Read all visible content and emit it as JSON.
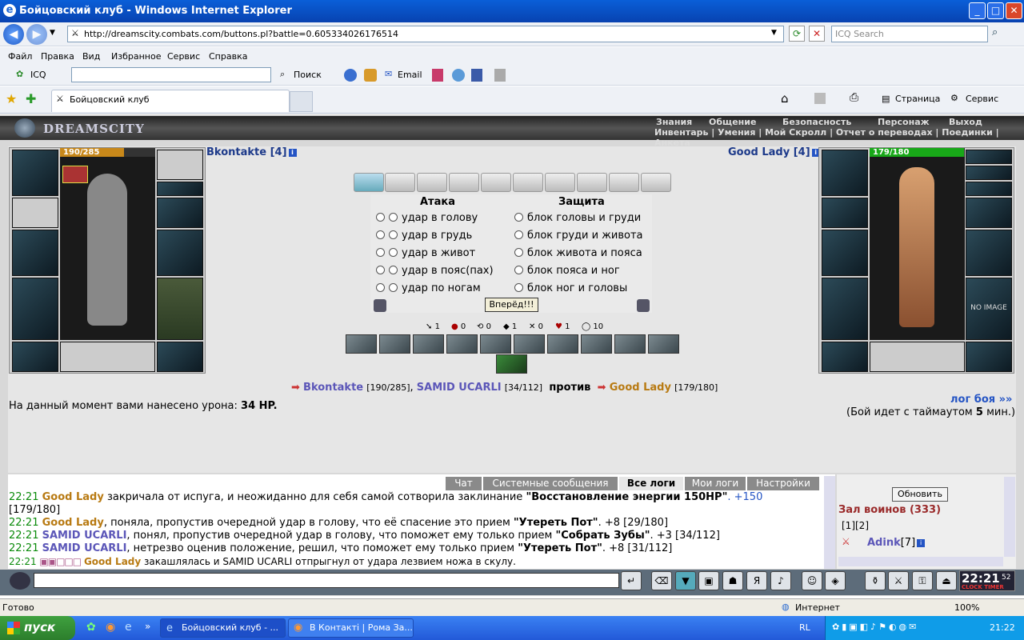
{
  "browser": {
    "window_title": "Бойцовский клуб - Windows Internet Explorer",
    "url": "http://dreamscity.combats.com/buttons.pl?battle=0.605334026176514",
    "search_placeholder": "ICQ Search",
    "menu": [
      "Файл",
      "Правка",
      "Вид",
      "Избранное",
      "Сервис",
      "Справка"
    ],
    "toolbar": {
      "icq": "ICQ",
      "search": "Поиск",
      "email": "Email"
    },
    "tab_title": "Бойцовский клуб",
    "cmd": {
      "page": "Страница",
      "service": "Сервис"
    },
    "status_left": "Готово",
    "status_zone": "Интернет",
    "zoom": "100%"
  },
  "game": {
    "logo": "DREAMSCITY",
    "nav_top": [
      "Знания",
      "Общение",
      "Безопасность",
      "Персонаж",
      "Выход"
    ],
    "nav_bottom": "Инвентарь | Умения | Мой Скролл | Отчет о переводах | Поединки | Анкета",
    "player": {
      "name": "Bkontakte [4]",
      "hp": "190/285",
      "hp_fraction": 0.67
    },
    "opponent": {
      "name": "Good Lady [4]",
      "hp": "179/180",
      "hp_fraction": 0.99,
      "no_image": "NO IMAGE"
    },
    "attack_title": "Атака",
    "defense_title": "Защита",
    "attacks": [
      "удар в голову",
      "удар в грудь",
      "удар в живот",
      "удар в пояс(пах)",
      "удар по ногам"
    ],
    "blocks": [
      "блок головы и груди",
      "блок груди и живота",
      "блок живота и пояса",
      "блок пояса и ног",
      "блок ног и головы"
    ],
    "go_button": "Вперёд!!!",
    "stats": [
      "1",
      "0",
      "0",
      "1",
      "0",
      "1",
      "10"
    ],
    "vs": {
      "p1": "Bkontakte",
      "p1_hp": "[190/285]",
      "p2": "SAMID UCARLI",
      "p2_hp": "[34/112]",
      "against": "против",
      "p3": "Good Lady",
      "p3_hp": "[179/180]"
    },
    "damage_label": "На данный момент вами нанесено урона:",
    "damage_value": "34 HP.",
    "log_link": "лог боя »»",
    "timeout_pre": "(Бой идет с таймаутом",
    "timeout_val": "5",
    "timeout_post": "мин.)"
  },
  "chat": {
    "tabs": [
      "Чат",
      "Системные сообщения",
      "Все логи",
      "Мои логи",
      "Настройки"
    ],
    "lines": [
      {
        "time": "22:21",
        "name": "Good Lady",
        "text": "закричала от испуга, и неожиданно для себя самой сотворила заклинание",
        "bold": "\"Восстановление энергии 150HP\"",
        "tail": ". +150"
      },
      {
        "time": "",
        "name": "",
        "text": "[179/180]",
        "bold": "",
        "tail": ""
      },
      {
        "time": "22:21",
        "name": "Good Lady",
        "text": ", поняла, пропустив очередной удар в голову, что её спасение это прием",
        "bold": "\"Утереть Пот\"",
        "tail": ". +8 [29/180]"
      },
      {
        "time": "22:21",
        "name": "SAMID UCARLI",
        "text": ", понял, пропустив очередной удар в голову, что поможет ему только прием",
        "bold": "\"Собрать Зубы\"",
        "tail": ". +3 [34/112]"
      },
      {
        "time": "22:21",
        "name": "SAMID UCARLI",
        "text": ", нетрезво оценив положение, решил, что поможет ему только прием",
        "bold": "\"Утереть Пот\"",
        "tail": ". +8 [31/112]"
      },
      {
        "time": "22:21",
        "name": "Good Lady",
        "text": "закашлялась и SAMID UCARLI отпрыгнул от удара лезвием ножа в скулу.",
        "bold": "",
        "tail": ""
      }
    ]
  },
  "room": {
    "refresh": "Обновить",
    "title": "Зал воинов (333)",
    "pages": "[1][2]",
    "player": "Adink",
    "level": "[7]"
  },
  "clock": "22:21",
  "clock_sec": "52",
  "clock_label": "CLOCK TIMER",
  "taskbar": {
    "start": "пуск",
    "tasks": [
      "Бойцовский клуб - ...",
      "В Контакті | Рома За..."
    ],
    "lang": "RL",
    "time": "21:22"
  }
}
